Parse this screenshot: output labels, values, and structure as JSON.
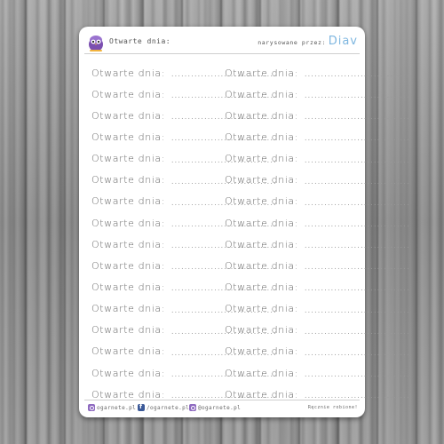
{
  "header": {
    "title": "Otwarte dnia:",
    "credit": "narysowane przez:",
    "author": "Diav"
  },
  "sticker": {
    "label": "Otwarte dnia:",
    "dots": "................................",
    "rows": 16,
    "columns": 2
  },
  "footer": {
    "instagram_handle": "ogarnete.pl",
    "facebook_handle": "/ogarnete.pl",
    "instagram_handle_2": "@ogarnete.pl",
    "note": "Ręcznie robione!"
  },
  "colors": {
    "author_accent": "#7fb7e0",
    "logo_purple": "#7b4fb0",
    "instagram": "#8e6ac0",
    "facebook": "#3b5998"
  },
  "icons": {
    "logo": "owl-mascot-icon",
    "instagram": "instagram-icon",
    "facebook": "facebook-icon"
  }
}
